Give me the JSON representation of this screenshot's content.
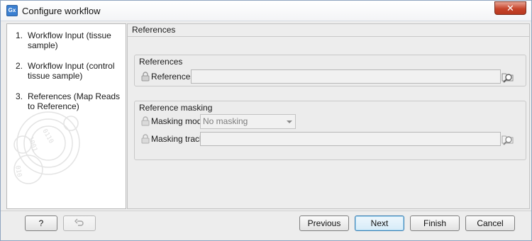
{
  "window": {
    "app_icon_text": "Gx",
    "title": "Configure workflow",
    "close_glyph": "✕"
  },
  "sidebar": {
    "steps": [
      {
        "num": "1.",
        "label": "Workflow Input (tissue sample)"
      },
      {
        "num": "2.",
        "label": "Workflow Input (control tissue sample)"
      },
      {
        "num": "3.",
        "label": "References (Map Reads to Reference)"
      }
    ],
    "decoration": "clc-bio-watermark"
  },
  "content": {
    "title": "References",
    "references_group": {
      "title": "References",
      "field_label": "References",
      "field_value": "",
      "lock_icon": "lock-icon",
      "browse_icon": "browse-folder-icon"
    },
    "masking_group": {
      "title": "Reference masking",
      "mode_label": "Masking mode",
      "mode_value": "No masking",
      "track_label": "Masking track",
      "track_value": "",
      "lock_icon": "lock-icon",
      "browse_icon": "browse-folder-icon"
    }
  },
  "buttons": {
    "help": "?",
    "reset_icon": "undo-icon",
    "previous": "Previous",
    "next": "Next",
    "finish": "Finish",
    "cancel": "Cancel"
  },
  "colors": {
    "accent": "#3c7fb1",
    "close_button": "#c6452b",
    "panel_bg": "#ededed"
  }
}
